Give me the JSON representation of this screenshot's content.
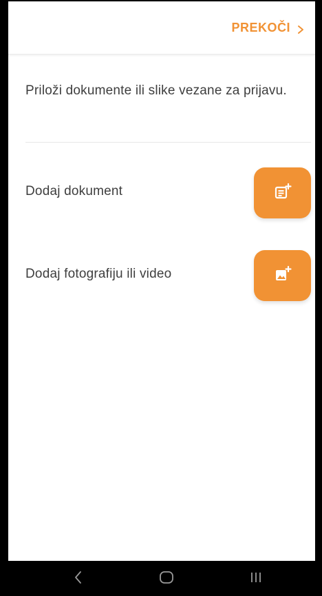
{
  "header": {
    "skip_label": "PREKOČI",
    "skip_icon": "chevron-right-icon"
  },
  "content": {
    "intro_text": "Priloži dokumente ili slike vezane za prijavu.",
    "actions": [
      {
        "label": "Dodaj dokument",
        "icon": "add-document-icon"
      },
      {
        "label": "Dodaj fotografiju ili video",
        "icon": "add-photo-icon"
      }
    ]
  },
  "system_nav": {
    "back_icon": "back-icon",
    "home_icon": "home-icon",
    "recent_icon": "recent-apps-icon"
  },
  "colors": {
    "accent": "#f19234",
    "text": "#3e3e3e",
    "divider": "#e6e6e6",
    "nav_bar": "#000000",
    "nav_icons": "#9a9a9a"
  }
}
